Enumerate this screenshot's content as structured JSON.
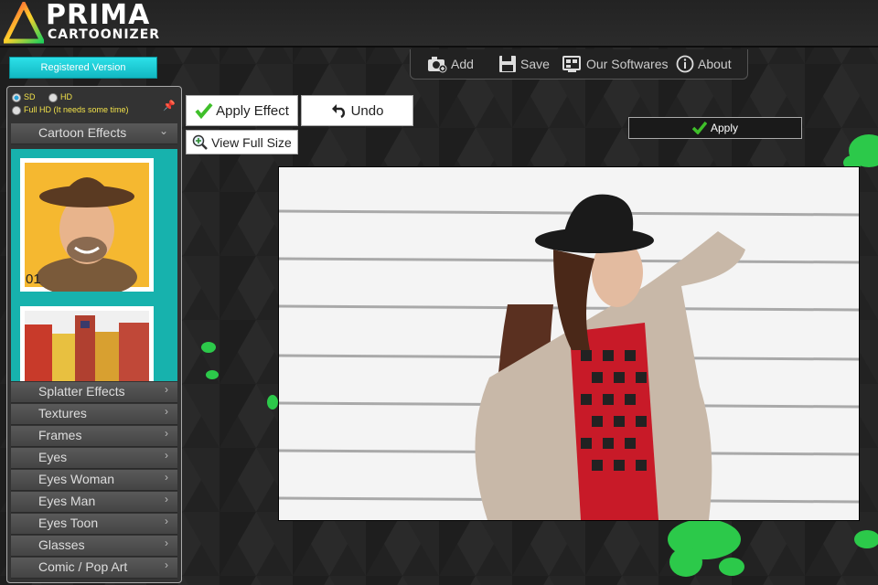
{
  "app": {
    "logo_line1": "PRIMA",
    "logo_line2": "CARTOONIZER",
    "registered_label": "Registered Version"
  },
  "toolbar": {
    "items": [
      {
        "label": "Add",
        "icon": "add-photo-icon"
      },
      {
        "label": "Save",
        "icon": "floppy-disk-icon"
      },
      {
        "label": "Our Softwares",
        "icon": "software-icon"
      },
      {
        "label": "About",
        "icon": "info-icon"
      }
    ]
  },
  "quality": {
    "options": [
      {
        "label": "SD",
        "selected": true
      },
      {
        "label": "HD",
        "selected": false
      },
      {
        "label": "Full HD (It needs some time)",
        "selected": false
      }
    ]
  },
  "effects": {
    "open_category": "Cartoon Effects",
    "thumb_number": "01",
    "categories": [
      "Splatter Effects",
      "Textures",
      "Frames",
      "Eyes",
      "Eyes Woman",
      "Eyes Man",
      "Eyes Toon",
      "Glasses",
      "Comic / Pop Art"
    ]
  },
  "actions": {
    "apply_effect": "Apply Effect",
    "undo": "Undo",
    "view_full_size": "View Full Size",
    "apply": "Apply"
  },
  "colors": {
    "accent_cyan": "#17b2ad",
    "check_green": "#3fbf2a",
    "quality_text": "#f2e24a"
  }
}
